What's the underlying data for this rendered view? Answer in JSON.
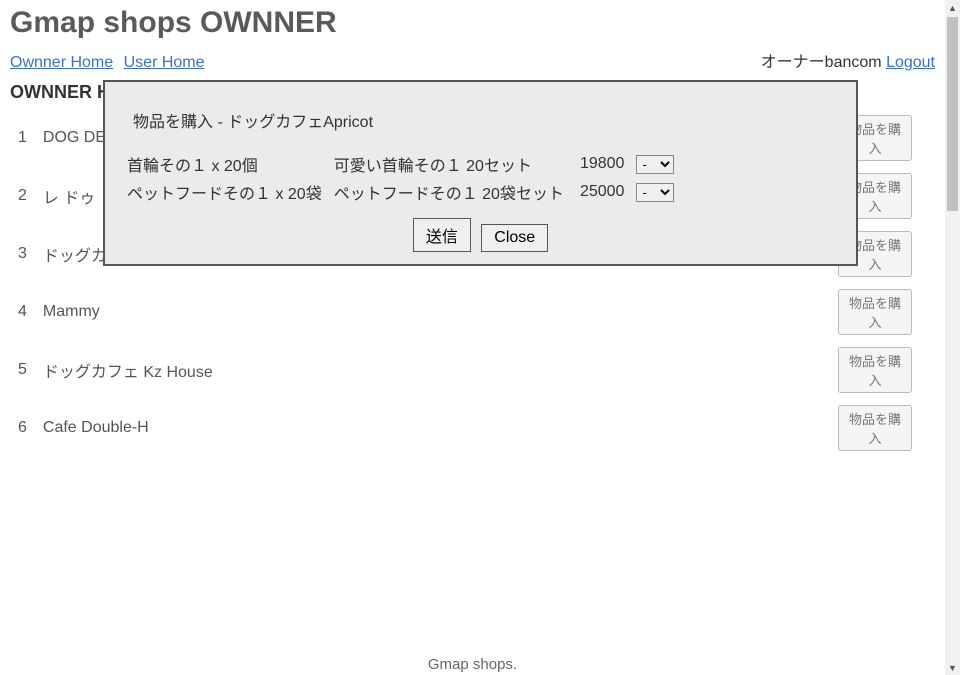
{
  "page_title": "Gmap shops OWNNER",
  "nav": {
    "ownner_home_label": "Ownner Home",
    "user_home_label": "User Home"
  },
  "user_area": {
    "owner_label": "オーナーbancom",
    "logout_label": "Logout"
  },
  "sub_heading": "OWNNER HOME",
  "shops": [
    {
      "idx": "1",
      "name": "DOG DEPT"
    },
    {
      "idx": "2",
      "name": "レ ドゥ"
    },
    {
      "idx": "3",
      "name": "ドッグカ"
    },
    {
      "idx": "4",
      "name": "Mammy"
    },
    {
      "idx": "5",
      "name": "ドッグカフェ Kz House"
    },
    {
      "idx": "6",
      "name": "Cafe Double-H"
    }
  ],
  "buy_button_label": "物品を購入",
  "footer_text": "Gmap shops.",
  "modal": {
    "title": "物品を購入 - ドッグカフェApricot",
    "rows": [
      {
        "c1": "首輪その１ x 20個",
        "c2": "可愛い首輪その１ 20セット",
        "price": "19800",
        "qty": "-"
      },
      {
        "c1": "ペットフードその１ x 20袋",
        "c2": "ペットフードその１ 20袋セット",
        "price": "25000",
        "qty": "-"
      }
    ],
    "submit_label": "送信",
    "close_label": "Close"
  }
}
